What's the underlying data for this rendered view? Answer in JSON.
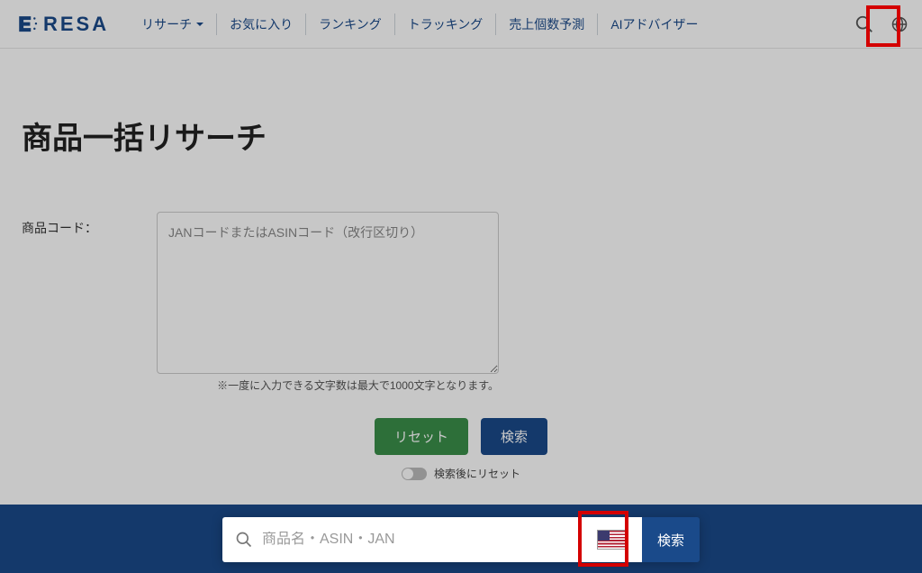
{
  "header": {
    "logo_text": "RESA",
    "nav": [
      "リサーチ",
      "お気に入り",
      "ランキング",
      "トラッキング",
      "売上個数予測",
      "AIアドバイザー"
    ]
  },
  "page": {
    "title": "商品一括リサーチ"
  },
  "form": {
    "label": "商品コード：",
    "placeholder": "JANコードまたはASINコード（改行区切り）",
    "helper": "※一度に入力できる文字数は最大で1000文字となります。",
    "reset_label": "リセット",
    "search_label": "検索",
    "toggle_label": "検索後にリセット"
  },
  "popup": {
    "placeholder": "商品名・ASIN・JAN",
    "search_label": "検索"
  }
}
